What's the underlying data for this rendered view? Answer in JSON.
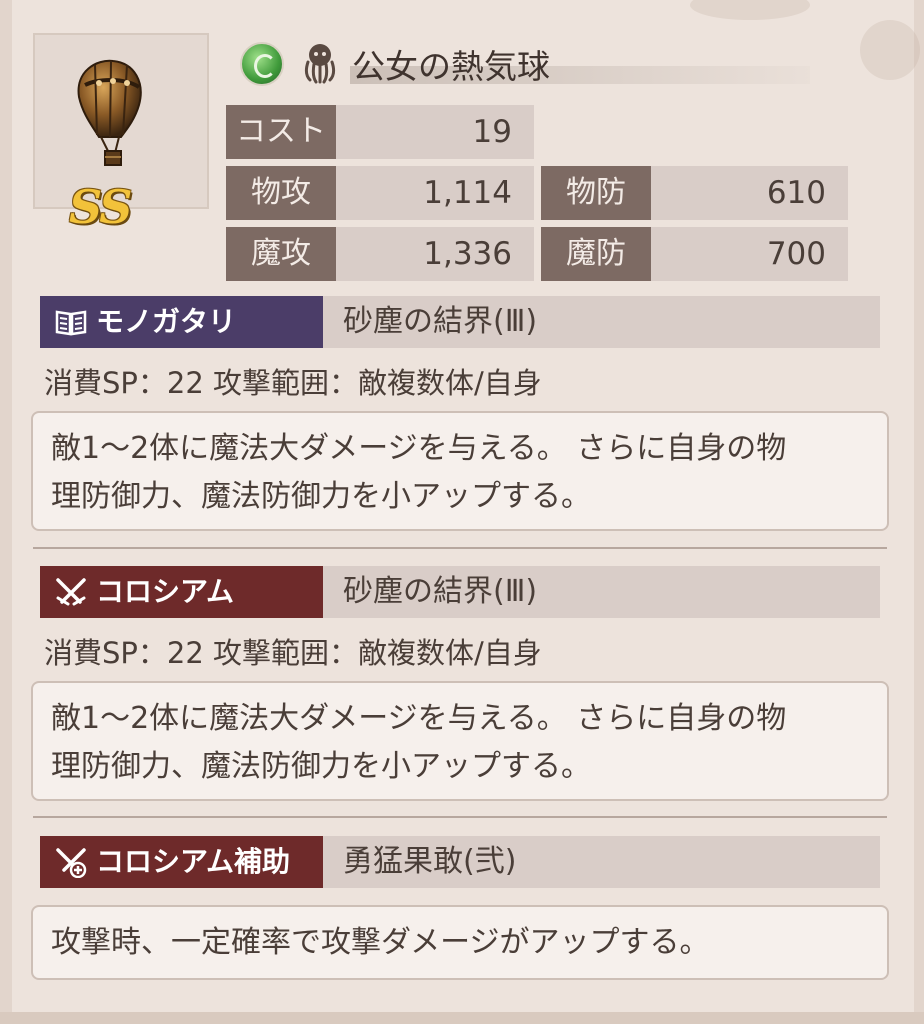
{
  "item": {
    "rank": "SS",
    "name": "公女の熱気球",
    "element_icon": "green-element-orb-icon",
    "type_icon": "octopus-icon"
  },
  "stats": {
    "cost": {
      "label": "コスト",
      "value": "19"
    },
    "patk": {
      "label": "物攻",
      "value": "1,114"
    },
    "pdef": {
      "label": "物防",
      "value": "610"
    },
    "matk": {
      "label": "魔攻",
      "value": "1,336"
    },
    "mdef": {
      "label": "魔防",
      "value": "700"
    }
  },
  "sections": [
    {
      "tag": "モノガタリ",
      "icon": "book-icon",
      "skill_name": "砂塵の結界(Ⅲ)",
      "sp_line": "消費SP：22 攻撃範囲：敵複数体/自身",
      "description_line1": "敵1～2体に魔法大ダメージを与える。 さらに自身の物",
      "description_line2": "理防御力、魔法防御力を小アップする。"
    },
    {
      "tag": "コロシアム",
      "icon": "crossed-swords-icon",
      "skill_name": "砂塵の結界(Ⅲ)",
      "sp_line": "消費SP：22 攻撃範囲：敵複数体/自身",
      "description_line1": "敵1～2体に魔法大ダメージを与える。 さらに自身の物",
      "description_line2": "理防御力、魔法防御力を小アップする。"
    },
    {
      "tag": "コロシアム補助",
      "icon": "sword-support-icon",
      "skill_name": "勇猛果敢(弐)",
      "description_line1": "攻撃時、一定確率で攻撃ダメージがアップする。"
    }
  ],
  "colors": {
    "stat_label_bg": "#7d6a63",
    "monogatari_tag_bg": "#4b3d68",
    "colosseum_tag_bg": "#6e2a2a",
    "rank_gold": "#f2c23a"
  }
}
